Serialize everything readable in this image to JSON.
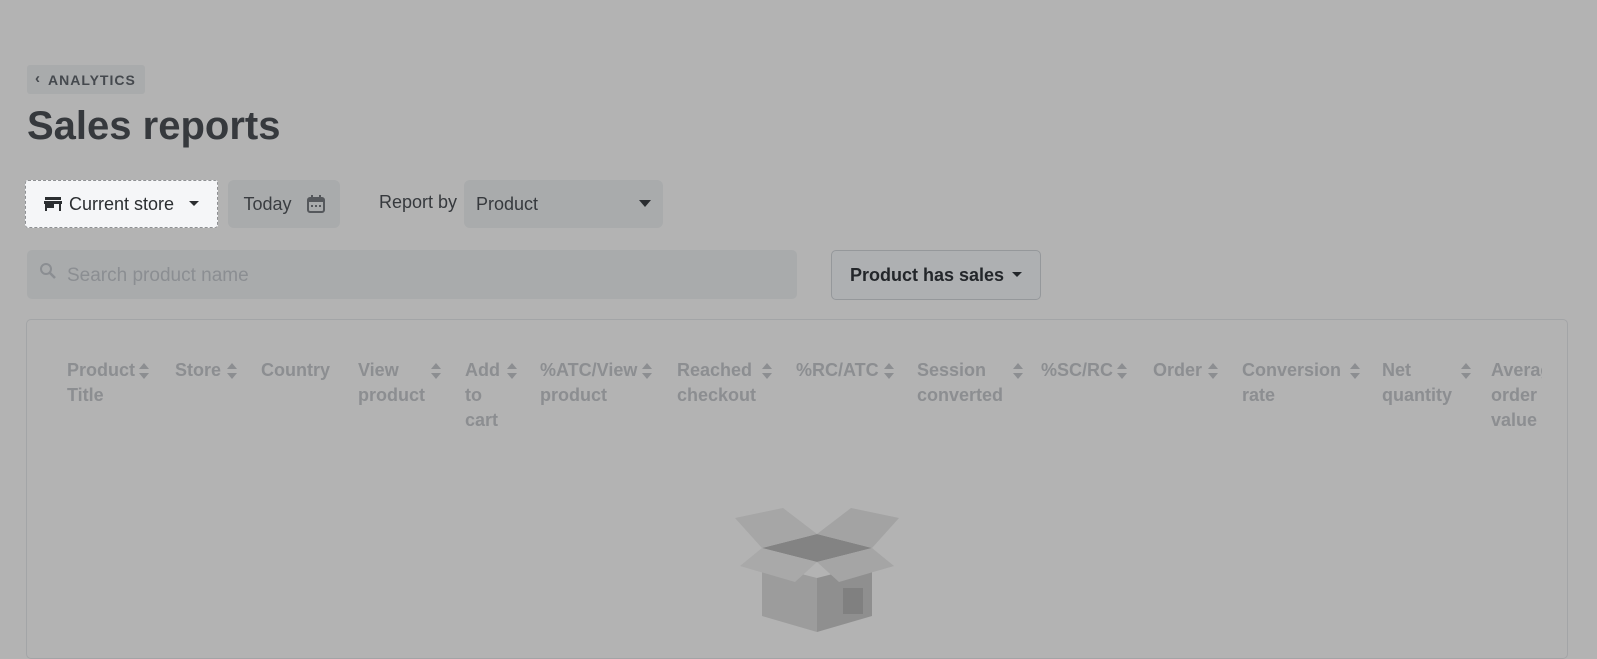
{
  "breadcrumb": {
    "label": "ANALYTICS"
  },
  "page": {
    "title": "Sales reports"
  },
  "filters": {
    "store_button": "Current store",
    "date_button": "Today",
    "report_by_label": "Report by",
    "report_by_value": "Product",
    "sales_filter": "Product has sales"
  },
  "search": {
    "placeholder": "Search product name",
    "value": ""
  },
  "table": {
    "columns": [
      {
        "label": "Product Title"
      },
      {
        "label": "Store"
      },
      {
        "label": "Country"
      },
      {
        "label": "View product"
      },
      {
        "label": "Add to cart"
      },
      {
        "label": "%ATC/View product"
      },
      {
        "label": "Reached checkout"
      },
      {
        "label": "%RC/ATC"
      },
      {
        "label": "Session converted"
      },
      {
        "label": "%SC/RC"
      },
      {
        "label": "Order"
      },
      {
        "label": "Conversion rate"
      },
      {
        "label": "Net quantity"
      },
      {
        "label": "Average order value"
      }
    ]
  },
  "colors": {
    "overlay_bg": "#b3b3b3",
    "active_button_bg": "#f5f6f8",
    "header_text": "#8c8e91"
  }
}
